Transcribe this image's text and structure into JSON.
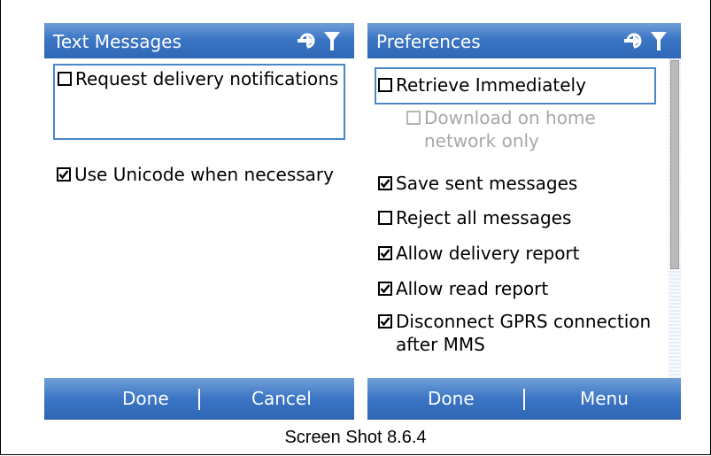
{
  "left_screen": {
    "title": "Text Messages",
    "options": [
      {
        "label": "Request delivery notifications",
        "checked": false
      },
      {
        "label": "Use Unicode when necessary",
        "checked": true
      }
    ],
    "softkeys": {
      "left": "Done",
      "right": "Cancel"
    }
  },
  "right_screen": {
    "title": "Preferences",
    "options": [
      {
        "label": "Retrieve Immediately",
        "checked": false
      },
      {
        "label_line1": "Download on home",
        "label_line2": "network only",
        "checked": false,
        "disabled": true
      },
      {
        "label": "Save sent messages",
        "checked": true
      },
      {
        "label": "Reject all messages",
        "checked": false
      },
      {
        "label": "Allow delivery report",
        "checked": true
      },
      {
        "label": "Allow read report",
        "checked": true
      },
      {
        "label_line1": "Disconnect GPRS connection",
        "label_line2": "after MMS",
        "checked": true
      }
    ],
    "softkeys": {
      "left": "Done",
      "right": "Menu"
    }
  },
  "caption": "Screen Shot 8.6.4",
  "colors": {
    "title_blue": "#3b75c4",
    "focus_blue": "#4a86c8",
    "disabled_gray": "#a8a8a8"
  },
  "icons": [
    "connectivity-icon",
    "signal-antenna-icon",
    "checkmark-icon"
  ]
}
